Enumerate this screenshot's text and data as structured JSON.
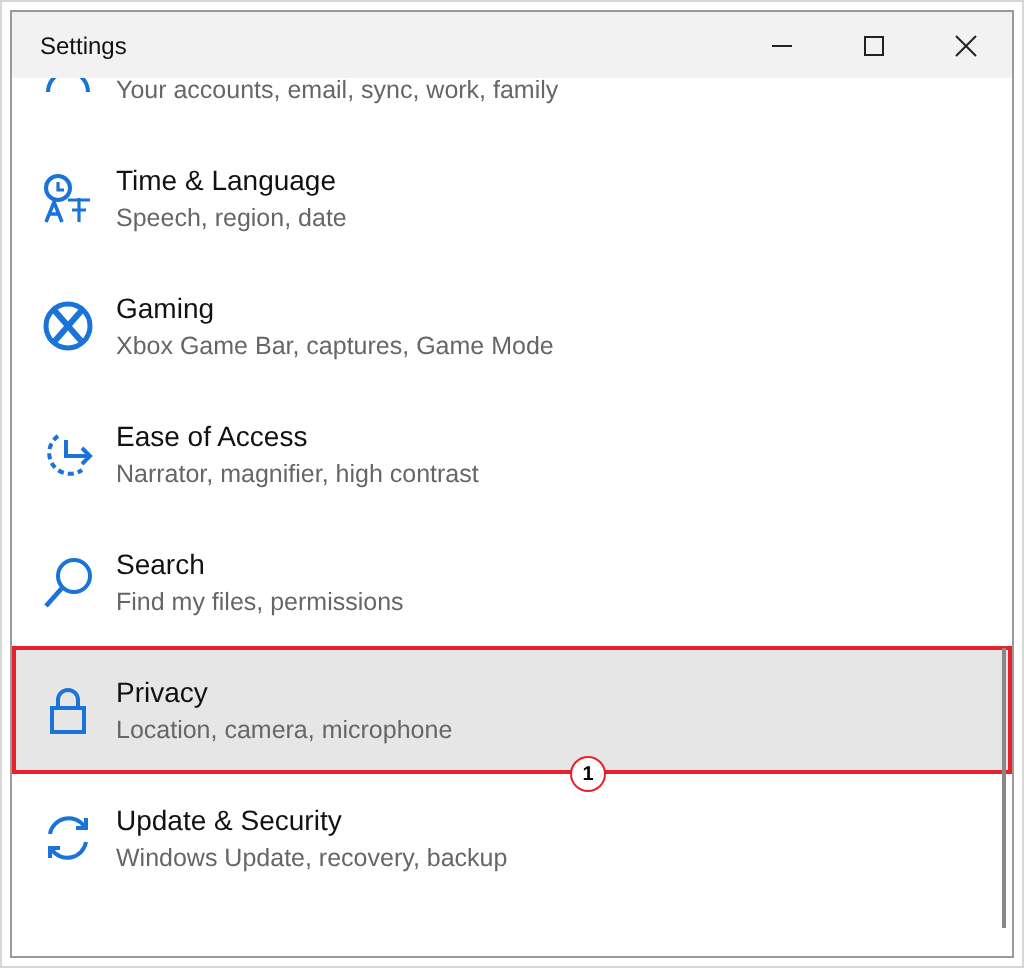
{
  "window": {
    "title": "Settings"
  },
  "partial_item": {
    "subtitle": "Your accounts, email, sync, work, family"
  },
  "items": [
    {
      "kind": "time",
      "title": "Time & Language",
      "subtitle": "Speech, region, date",
      "selected": false
    },
    {
      "kind": "gaming",
      "title": "Gaming",
      "subtitle": "Xbox Game Bar, captures, Game Mode",
      "selected": false
    },
    {
      "kind": "ease",
      "title": "Ease of Access",
      "subtitle": "Narrator, magnifier, high contrast",
      "selected": false
    },
    {
      "kind": "search",
      "title": "Search",
      "subtitle": "Find my files, permissions",
      "selected": false
    },
    {
      "kind": "privacy",
      "title": "Privacy",
      "subtitle": "Location, camera, microphone",
      "selected": true
    },
    {
      "kind": "update",
      "title": "Update & Security",
      "subtitle": "Windows Update, recovery, backup",
      "selected": false
    }
  ],
  "annotation": {
    "label": "1"
  }
}
